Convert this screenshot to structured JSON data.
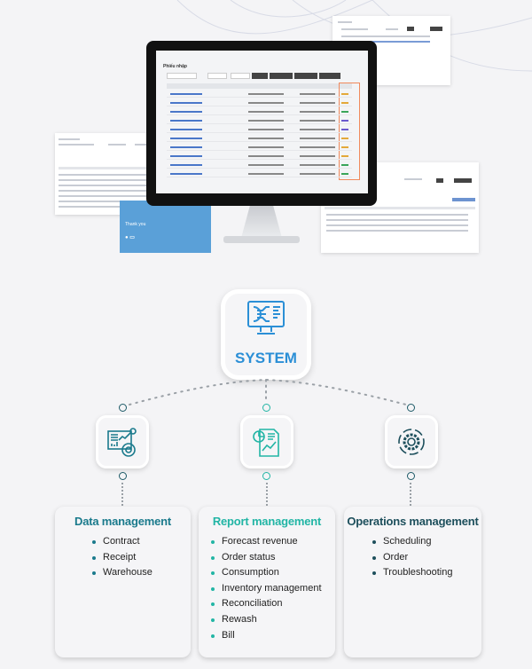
{
  "collage": {
    "monitor_page_title": "Phiếu nhập",
    "thank_you": "Thank you"
  },
  "system": {
    "title": "SYSTEM",
    "icon": "monitor-network-icon",
    "color": "#2b8fd6"
  },
  "modules": [
    {
      "title": "Data management",
      "icon": "dashboard-analytics-icon",
      "color": "#1a7a8c",
      "items": [
        "Contract",
        "Receipt",
        "Warehouse"
      ]
    },
    {
      "title": "Report management",
      "icon": "report-document-icon",
      "color": "#22b5a5",
      "items": [
        "Forecast revenue",
        "Order status",
        "Consumption",
        "Inventory management",
        "Reconciliation",
        "Rewash",
        "Bill"
      ]
    },
    {
      "title": "Operations management",
      "icon": "gear-cycle-icon",
      "color": "#1d4f5c",
      "items": [
        "Scheduling",
        "Order",
        "Troubleshooting"
      ]
    }
  ]
}
